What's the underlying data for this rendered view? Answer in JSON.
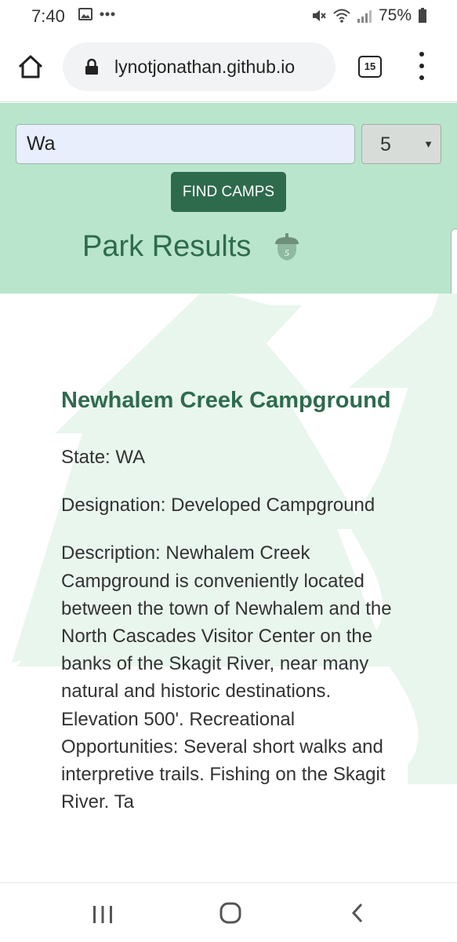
{
  "status_bar": {
    "time": "7:40",
    "battery": "75%",
    "icons": [
      "image-notification-icon",
      "more-notifications-icon",
      "mute-icon",
      "wifi-icon",
      "signal-icon",
      "battery-icon"
    ]
  },
  "browser": {
    "url": "lynotjonathan.github.io",
    "tab_count": "15"
  },
  "search": {
    "input_value": "Wa",
    "results_count": "5",
    "find_button_label": "FIND CAMPS"
  },
  "results": {
    "title": "Park Results",
    "badge_count": "5"
  },
  "park": {
    "name": "Newhalem Creek Campground",
    "state": "State: WA",
    "designation": "Designation: Developed Campground",
    "description": "Description: Newhalem Creek Campground is conveniently located between the town of Newhalem and the North Cascades Visitor Center on the banks of the Skagit River, near many natural and historic destinations. Elevation 500'. Recreational Opportunities: Several short walks and interpretive trails. Fishing on the Skagit River. Ta"
  },
  "colors": {
    "header_bg": "#b9e5cc",
    "accent": "#2e6b4d",
    "tree_bg": "#e9f6ee"
  }
}
